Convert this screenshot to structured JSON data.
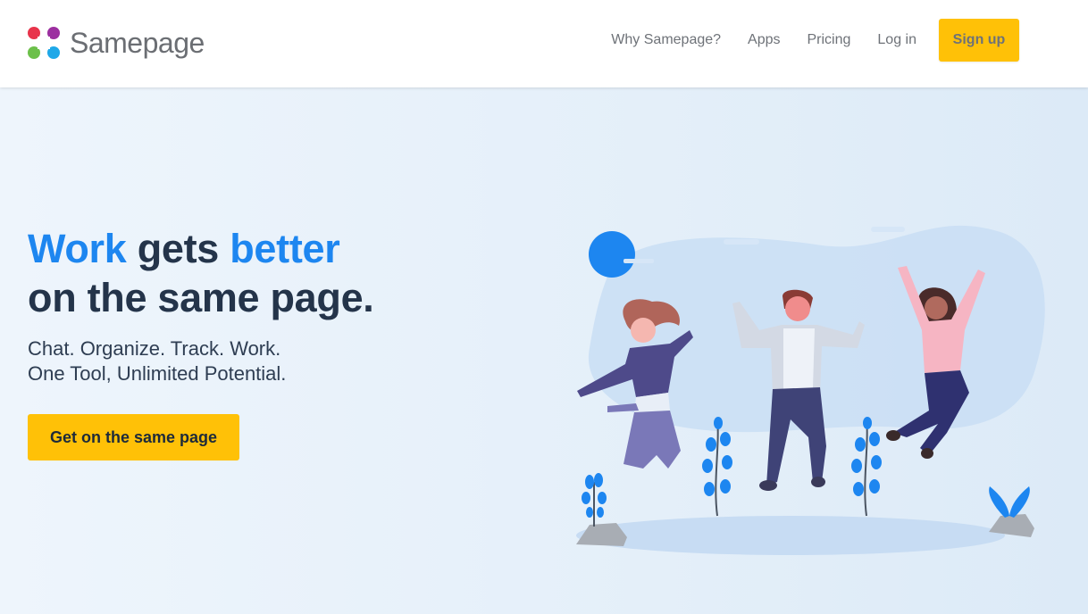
{
  "brand": {
    "name": "Samepage"
  },
  "nav": {
    "items": [
      {
        "label": "Why Samepage?"
      },
      {
        "label": "Apps"
      },
      {
        "label": "Pricing"
      },
      {
        "label": "Log in"
      }
    ],
    "signup_label": "Sign up"
  },
  "hero": {
    "headline": {
      "word1": "Work",
      "word2": "gets",
      "word3": "better",
      "line2": "on the same page."
    },
    "subline1": "Chat. Organize. Track. Work.",
    "subline2": "One Tool, Unlimited Potential.",
    "cta_label": "Get on the same page"
  },
  "colors": {
    "accent_blue": "#1d86f0",
    "button_yellow": "#ffc107",
    "headline_dark": "#24344a",
    "hero_bg": "#eaf2fb"
  },
  "icons": [
    "samepage-logo-icon",
    "hero-illustration"
  ]
}
